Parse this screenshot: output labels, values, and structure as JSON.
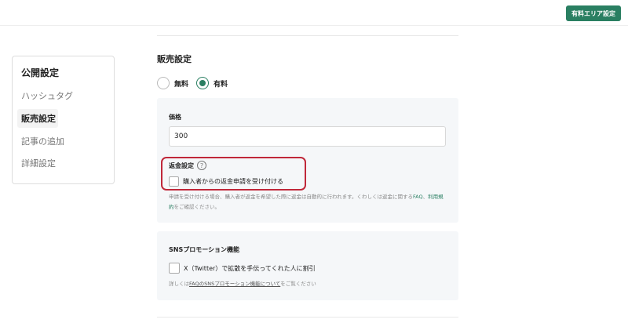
{
  "header": {
    "paid_area_button": "有料エリア設定"
  },
  "sidebar": {
    "title": "公開設定",
    "items": [
      {
        "label": "ハッシュタグ"
      },
      {
        "label": "販売設定"
      },
      {
        "label": "記事の追加"
      },
      {
        "label": "詳細設定"
      }
    ]
  },
  "sales": {
    "title": "販売設定",
    "option_free": "無料",
    "option_paid": "有料",
    "selected": "有料"
  },
  "price": {
    "label": "価格",
    "value": "300"
  },
  "refund": {
    "title": "返金設定",
    "help_glyph": "?",
    "checkbox_label": "購入者からの返金申請を受け付ける",
    "checked": false,
    "note_text": "申請を受け付ける場合、購入者が返金を希望した際に返金は自動的に行われます。くわしくは返金に関する",
    "note_link_faq": "FAQ",
    "note_sep": "、",
    "note_link_terms": "利用規約",
    "note_tail": "をご確認ください。"
  },
  "sns": {
    "title": "SNSプロモーション機能",
    "checkbox_label": "X（Twitter）で拡散を手伝ってくれた人に割引",
    "checked": false,
    "note_prefix": "詳しくは",
    "note_link": "FAQのSNSプロモーション機能について",
    "note_suffix": "をご覧ください"
  },
  "annotation": {
    "highlight_color": "#c0283a"
  },
  "colors": {
    "accent": "#2a7f62",
    "panel_bg": "#f5f7f9"
  }
}
